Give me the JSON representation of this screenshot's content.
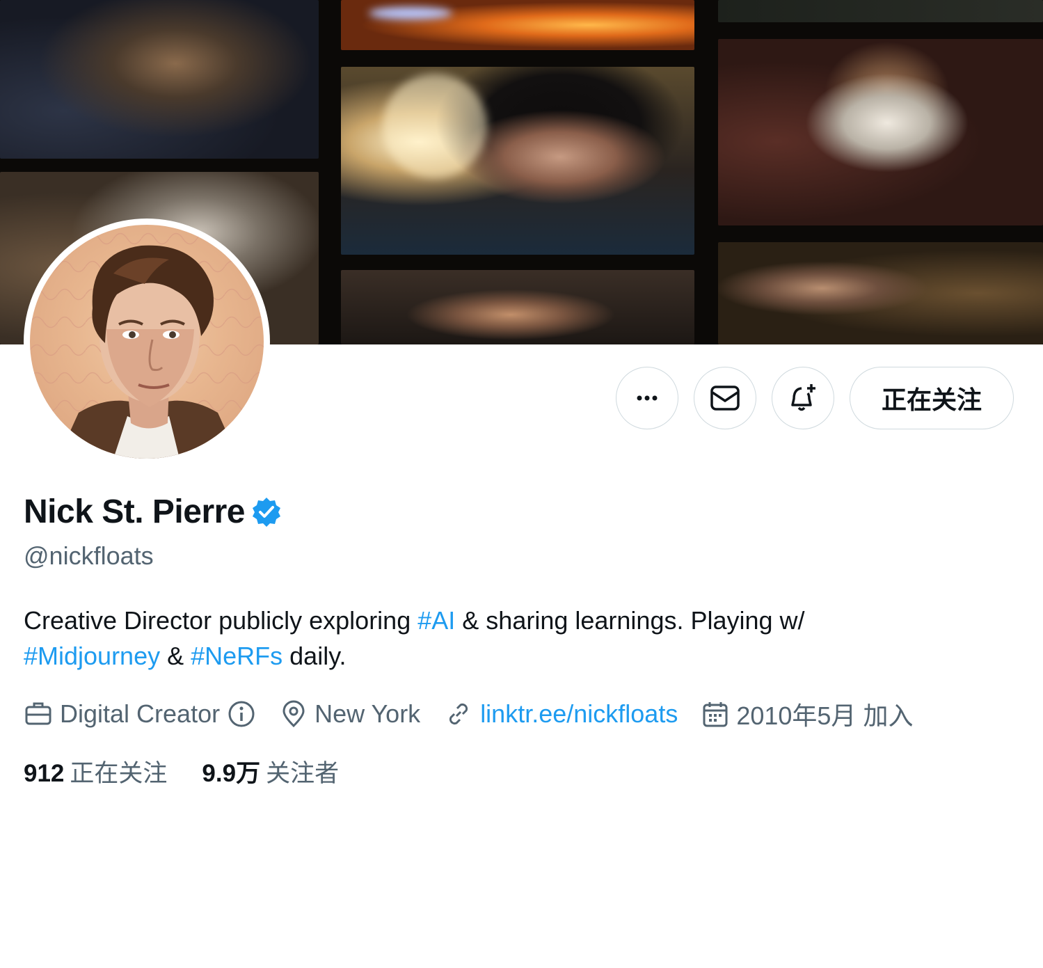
{
  "profile": {
    "name": "Nick St. Pierre",
    "verified_icon": "verified-badge-icon",
    "handle": "@nickfloats",
    "bio": {
      "part1": "Creative Director publicly exploring ",
      "tag1": "#AI",
      "part2": " & sharing learnings. Playing w/",
      "tag2": "#Midjourney",
      "part3": " & ",
      "tag3": "#NeRFs",
      "part4": " daily."
    },
    "meta": {
      "category": "Digital Creator",
      "location": "New York",
      "website": "linktr.ee/nickfloats",
      "joined": "2010年5月 加入"
    },
    "stats": {
      "following_count": "912",
      "following_label": "正在关注",
      "followers_count": "9.9万",
      "followers_label": "关注者"
    }
  },
  "actions": {
    "more_icon": "more-dots-icon",
    "message_icon": "envelope-icon",
    "notify_icon": "bell-plus-icon",
    "follow_label": "正在关注"
  },
  "colors": {
    "link": "#1d9bf0",
    "text_primary": "#0f1419",
    "text_secondary": "#536471",
    "border": "#cfd9de"
  }
}
